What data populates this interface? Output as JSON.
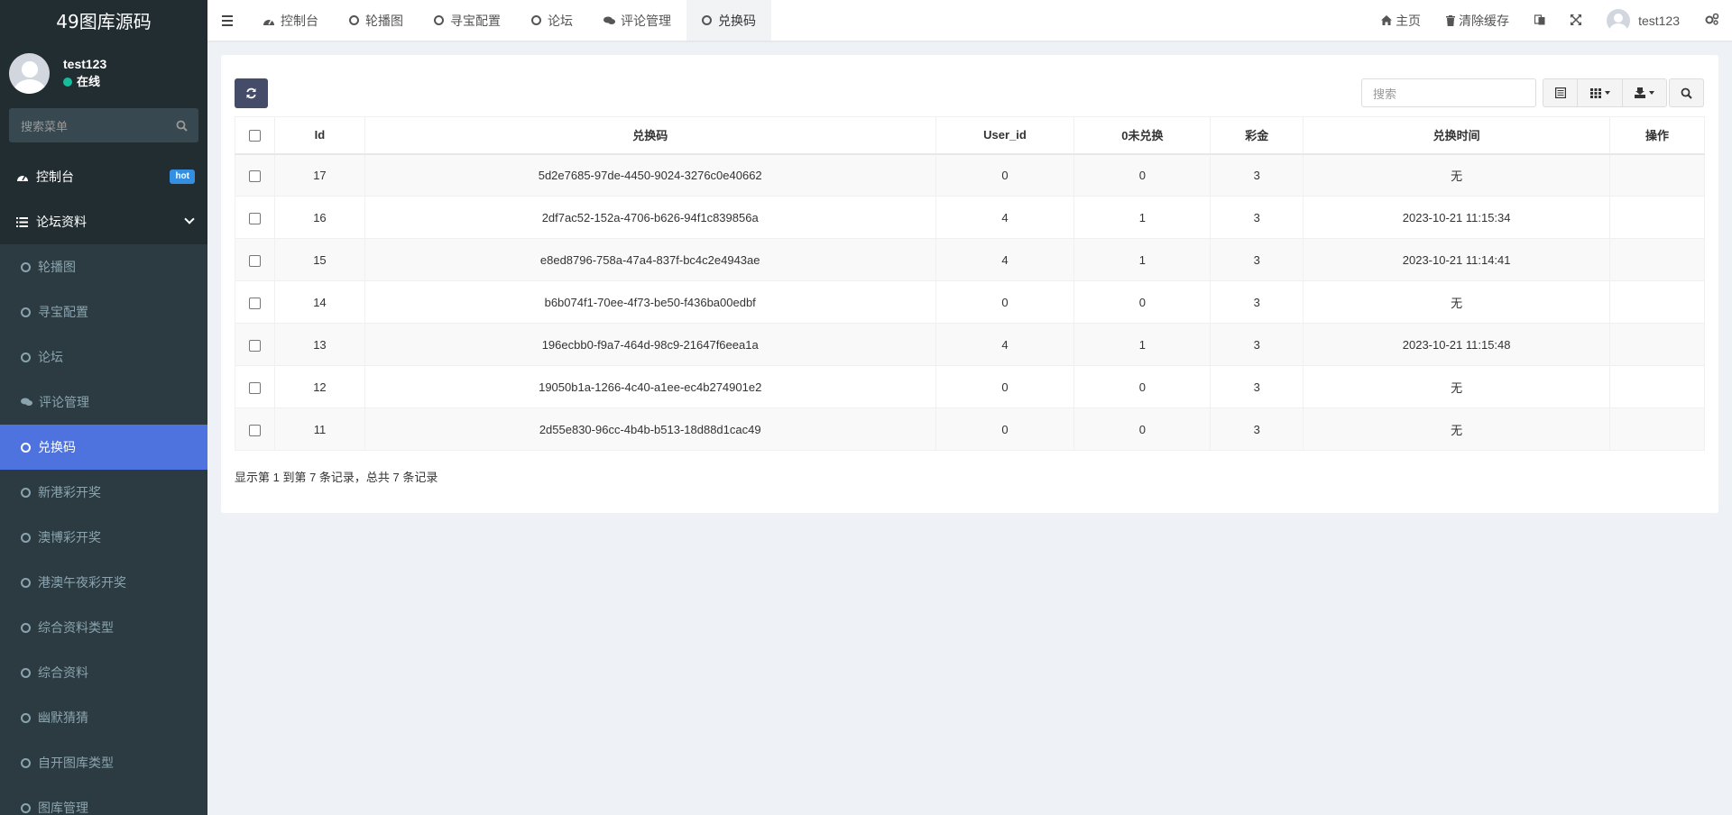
{
  "app": {
    "logo": "49图库源码"
  },
  "user": {
    "name": "test123",
    "status": "在线"
  },
  "sidebar": {
    "search_placeholder": "搜索菜单",
    "dashboard": {
      "label": "控制台",
      "badge": "hot"
    },
    "group": {
      "label": "论坛资料"
    },
    "items": [
      {
        "label": "轮播图",
        "icon": "circle-icon"
      },
      {
        "label": "寻宝配置",
        "icon": "circle-icon"
      },
      {
        "label": "论坛",
        "icon": "circle-icon"
      },
      {
        "label": "评论管理",
        "icon": "comments-icon"
      },
      {
        "label": "兑换码",
        "icon": "circle-icon",
        "active": true
      },
      {
        "label": "新港彩开奖",
        "icon": "circle-icon"
      },
      {
        "label": "澳博彩开奖",
        "icon": "circle-icon"
      },
      {
        "label": "港澳午夜彩开奖",
        "icon": "circle-icon"
      },
      {
        "label": "综合资料类型",
        "icon": "circle-icon"
      },
      {
        "label": "综合资料",
        "icon": "circle-icon"
      },
      {
        "label": "幽默猜猜",
        "icon": "circle-icon"
      },
      {
        "label": "自开图库类型",
        "icon": "circle-icon"
      },
      {
        "label": "图库管理",
        "icon": "circle-icon"
      }
    ]
  },
  "topbar": {
    "tabs": [
      {
        "label": "控制台",
        "icon": "dashboard-icon"
      },
      {
        "label": "轮播图",
        "icon": "circle-icon"
      },
      {
        "label": "寻宝配置",
        "icon": "circle-icon"
      },
      {
        "label": "论坛",
        "icon": "circle-icon"
      },
      {
        "label": "评论管理",
        "icon": "comments-icon"
      },
      {
        "label": "兑换码",
        "icon": "circle-icon",
        "active": true
      }
    ],
    "home_label": "主页",
    "clear_cache_label": "清除缓存",
    "username": "test123"
  },
  "toolbar": {
    "search_placeholder": "搜索"
  },
  "table": {
    "columns": [
      "Id",
      "兑换码",
      "User_id",
      "0未兑换",
      "彩金",
      "兑换时间",
      "操作"
    ],
    "rows": [
      {
        "id": "17",
        "code": "5d2e7685-97de-4450-9024-3276c0e40662",
        "user_id": "0",
        "status": "0",
        "bonus": "3",
        "time": "无",
        "op": ""
      },
      {
        "id": "16",
        "code": "2df7ac52-152a-4706-b626-94f1c839856a",
        "user_id": "4",
        "status": "1",
        "bonus": "3",
        "time": "2023-10-21 11:15:34",
        "op": ""
      },
      {
        "id": "15",
        "code": "e8ed8796-758a-47a4-837f-bc4c2e4943ae",
        "user_id": "4",
        "status": "1",
        "bonus": "3",
        "time": "2023-10-21 11:14:41",
        "op": ""
      },
      {
        "id": "14",
        "code": "b6b074f1-70ee-4f73-be50-f436ba00edbf",
        "user_id": "0",
        "status": "0",
        "bonus": "3",
        "time": "无",
        "op": ""
      },
      {
        "id": "13",
        "code": "196ecbb0-f9a7-464d-98c9-21647f6eea1a",
        "user_id": "4",
        "status": "1",
        "bonus": "3",
        "time": "2023-10-21 11:15:48",
        "op": ""
      },
      {
        "id": "12",
        "code": "19050b1a-1266-4c40-a1ee-ec4b274901e2",
        "user_id": "0",
        "status": "0",
        "bonus": "3",
        "time": "无",
        "op": ""
      },
      {
        "id": "11",
        "code": "2d55e830-96cc-4b4b-b513-18d88d1cac49",
        "user_id": "0",
        "status": "0",
        "bonus": "3",
        "time": "无",
        "op": ""
      }
    ],
    "footer": "显示第 1 到第 7 条记录，总共 7 条记录"
  },
  "colors": {
    "sidebar_bg": "#222d32",
    "active": "#4e73df",
    "online": "#18bc9c",
    "refresh_btn": "#444c69",
    "hot_badge": "#348fe2"
  }
}
